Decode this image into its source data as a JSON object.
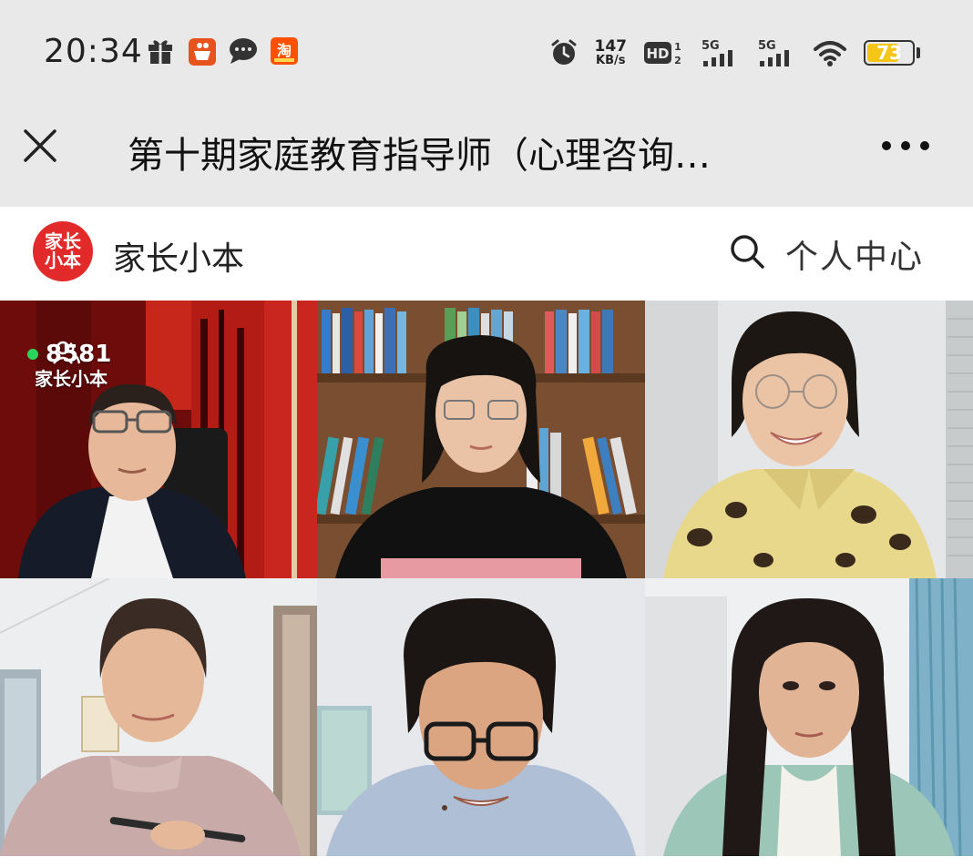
{
  "status_bar": {
    "time": "20:34",
    "net_speed_value": "147",
    "net_speed_unit": "KB/s",
    "hd_label": "HD",
    "sim1_label": "5G",
    "sim2_label": "5G",
    "battery_level": 73,
    "battery_text": "73",
    "battery_color": "#f5c518",
    "notification_icons": [
      "gift-icon",
      "basket-app-icon",
      "chat-bubble-icon",
      "taobao-app-icon"
    ]
  },
  "title_bar": {
    "title": "第十期家庭教育指导师（心理咨询…"
  },
  "app_header": {
    "logo_line1": "家长",
    "logo_line2": "小本",
    "brand_name": "家长小本",
    "profile_label": "个人中心",
    "brand_color": "#e32a2a"
  },
  "live": {
    "viewer_count": "8581",
    "watermark": "家长小本",
    "live_indicator_color": "#2bd45b"
  }
}
